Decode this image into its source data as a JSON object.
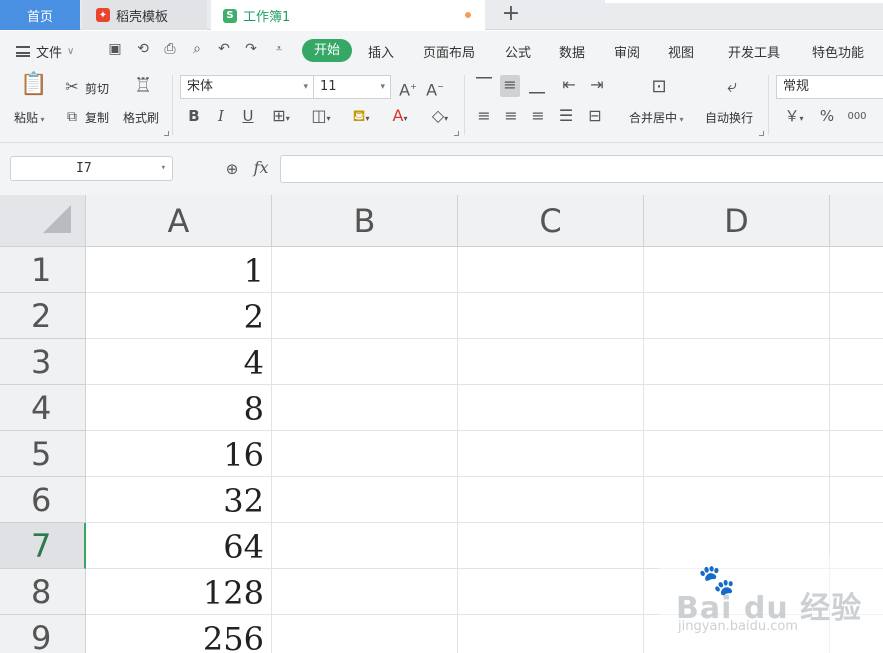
{
  "tabs": {
    "home": "首页",
    "docer": "稻壳模板",
    "document": "工作簿1",
    "new_tab": "+",
    "doc_icon": "S"
  },
  "menu": {
    "file": "文件",
    "start": "开始",
    "insert": "插入",
    "page_layout": "页面布局",
    "formulas": "公式",
    "data": "数据",
    "review": "审阅",
    "view": "视图",
    "developer": "开发工具",
    "special": "特色功能"
  },
  "ribbon": {
    "cut": "剪切",
    "copy": "复制",
    "format_painter": "格式刷",
    "paste": "粘贴",
    "font_name": "宋体",
    "font_size": "11",
    "bold": "B",
    "italic": "I",
    "underline": "U",
    "merge_center": "合并居中",
    "wrap_text": "自动换行",
    "number_format": "常规",
    "currency": "￥",
    "percent": "%",
    "thousands": "000"
  },
  "formula_bar": {
    "name_box": "I7",
    "fx": "fx",
    "formula": ""
  },
  "sheet": {
    "columns": [
      "A",
      "B",
      "C",
      "D"
    ],
    "rows": [
      "1",
      "2",
      "3",
      "4",
      "5",
      "6",
      "7",
      "8",
      "9"
    ],
    "active_row": "7",
    "column_a_values": [
      "1",
      "2",
      "4",
      "8",
      "16",
      "32",
      "64",
      "128",
      "256"
    ]
  },
  "watermark": {
    "text": "Bai du 经验",
    "sub": "jingyan.baidu.com"
  },
  "colors": {
    "accent_green": "#35a866",
    "home_tab_blue": "#4a90e2"
  }
}
